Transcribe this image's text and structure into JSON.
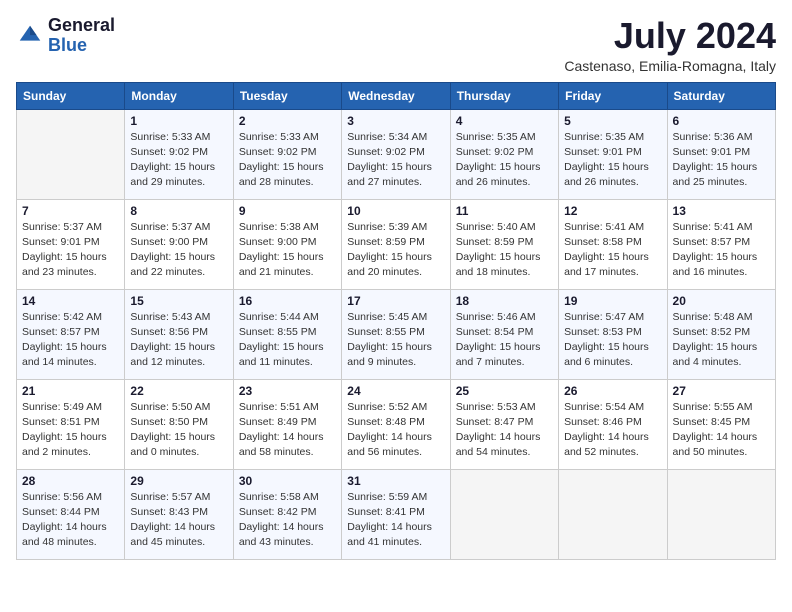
{
  "header": {
    "logo_general": "General",
    "logo_blue": "Blue",
    "month_title": "July 2024",
    "location": "Castenaso, Emilia-Romagna, Italy"
  },
  "days_of_week": [
    "Sunday",
    "Monday",
    "Tuesday",
    "Wednesday",
    "Thursday",
    "Friday",
    "Saturday"
  ],
  "weeks": [
    [
      {
        "day": "",
        "info": ""
      },
      {
        "day": "1",
        "info": "Sunrise: 5:33 AM\nSunset: 9:02 PM\nDaylight: 15 hours\nand 29 minutes."
      },
      {
        "day": "2",
        "info": "Sunrise: 5:33 AM\nSunset: 9:02 PM\nDaylight: 15 hours\nand 28 minutes."
      },
      {
        "day": "3",
        "info": "Sunrise: 5:34 AM\nSunset: 9:02 PM\nDaylight: 15 hours\nand 27 minutes."
      },
      {
        "day": "4",
        "info": "Sunrise: 5:35 AM\nSunset: 9:02 PM\nDaylight: 15 hours\nand 26 minutes."
      },
      {
        "day": "5",
        "info": "Sunrise: 5:35 AM\nSunset: 9:01 PM\nDaylight: 15 hours\nand 26 minutes."
      },
      {
        "day": "6",
        "info": "Sunrise: 5:36 AM\nSunset: 9:01 PM\nDaylight: 15 hours\nand 25 minutes."
      }
    ],
    [
      {
        "day": "7",
        "info": "Sunrise: 5:37 AM\nSunset: 9:01 PM\nDaylight: 15 hours\nand 23 minutes."
      },
      {
        "day": "8",
        "info": "Sunrise: 5:37 AM\nSunset: 9:00 PM\nDaylight: 15 hours\nand 22 minutes."
      },
      {
        "day": "9",
        "info": "Sunrise: 5:38 AM\nSunset: 9:00 PM\nDaylight: 15 hours\nand 21 minutes."
      },
      {
        "day": "10",
        "info": "Sunrise: 5:39 AM\nSunset: 8:59 PM\nDaylight: 15 hours\nand 20 minutes."
      },
      {
        "day": "11",
        "info": "Sunrise: 5:40 AM\nSunset: 8:59 PM\nDaylight: 15 hours\nand 18 minutes."
      },
      {
        "day": "12",
        "info": "Sunrise: 5:41 AM\nSunset: 8:58 PM\nDaylight: 15 hours\nand 17 minutes."
      },
      {
        "day": "13",
        "info": "Sunrise: 5:41 AM\nSunset: 8:57 PM\nDaylight: 15 hours\nand 16 minutes."
      }
    ],
    [
      {
        "day": "14",
        "info": "Sunrise: 5:42 AM\nSunset: 8:57 PM\nDaylight: 15 hours\nand 14 minutes."
      },
      {
        "day": "15",
        "info": "Sunrise: 5:43 AM\nSunset: 8:56 PM\nDaylight: 15 hours\nand 12 minutes."
      },
      {
        "day": "16",
        "info": "Sunrise: 5:44 AM\nSunset: 8:55 PM\nDaylight: 15 hours\nand 11 minutes."
      },
      {
        "day": "17",
        "info": "Sunrise: 5:45 AM\nSunset: 8:55 PM\nDaylight: 15 hours\nand 9 minutes."
      },
      {
        "day": "18",
        "info": "Sunrise: 5:46 AM\nSunset: 8:54 PM\nDaylight: 15 hours\nand 7 minutes."
      },
      {
        "day": "19",
        "info": "Sunrise: 5:47 AM\nSunset: 8:53 PM\nDaylight: 15 hours\nand 6 minutes."
      },
      {
        "day": "20",
        "info": "Sunrise: 5:48 AM\nSunset: 8:52 PM\nDaylight: 15 hours\nand 4 minutes."
      }
    ],
    [
      {
        "day": "21",
        "info": "Sunrise: 5:49 AM\nSunset: 8:51 PM\nDaylight: 15 hours\nand 2 minutes."
      },
      {
        "day": "22",
        "info": "Sunrise: 5:50 AM\nSunset: 8:50 PM\nDaylight: 15 hours\nand 0 minutes."
      },
      {
        "day": "23",
        "info": "Sunrise: 5:51 AM\nSunset: 8:49 PM\nDaylight: 14 hours\nand 58 minutes."
      },
      {
        "day": "24",
        "info": "Sunrise: 5:52 AM\nSunset: 8:48 PM\nDaylight: 14 hours\nand 56 minutes."
      },
      {
        "day": "25",
        "info": "Sunrise: 5:53 AM\nSunset: 8:47 PM\nDaylight: 14 hours\nand 54 minutes."
      },
      {
        "day": "26",
        "info": "Sunrise: 5:54 AM\nSunset: 8:46 PM\nDaylight: 14 hours\nand 52 minutes."
      },
      {
        "day": "27",
        "info": "Sunrise: 5:55 AM\nSunset: 8:45 PM\nDaylight: 14 hours\nand 50 minutes."
      }
    ],
    [
      {
        "day": "28",
        "info": "Sunrise: 5:56 AM\nSunset: 8:44 PM\nDaylight: 14 hours\nand 48 minutes."
      },
      {
        "day": "29",
        "info": "Sunrise: 5:57 AM\nSunset: 8:43 PM\nDaylight: 14 hours\nand 45 minutes."
      },
      {
        "day": "30",
        "info": "Sunrise: 5:58 AM\nSunset: 8:42 PM\nDaylight: 14 hours\nand 43 minutes."
      },
      {
        "day": "31",
        "info": "Sunrise: 5:59 AM\nSunset: 8:41 PM\nDaylight: 14 hours\nand 41 minutes."
      },
      {
        "day": "",
        "info": ""
      },
      {
        "day": "",
        "info": ""
      },
      {
        "day": "",
        "info": ""
      }
    ]
  ]
}
